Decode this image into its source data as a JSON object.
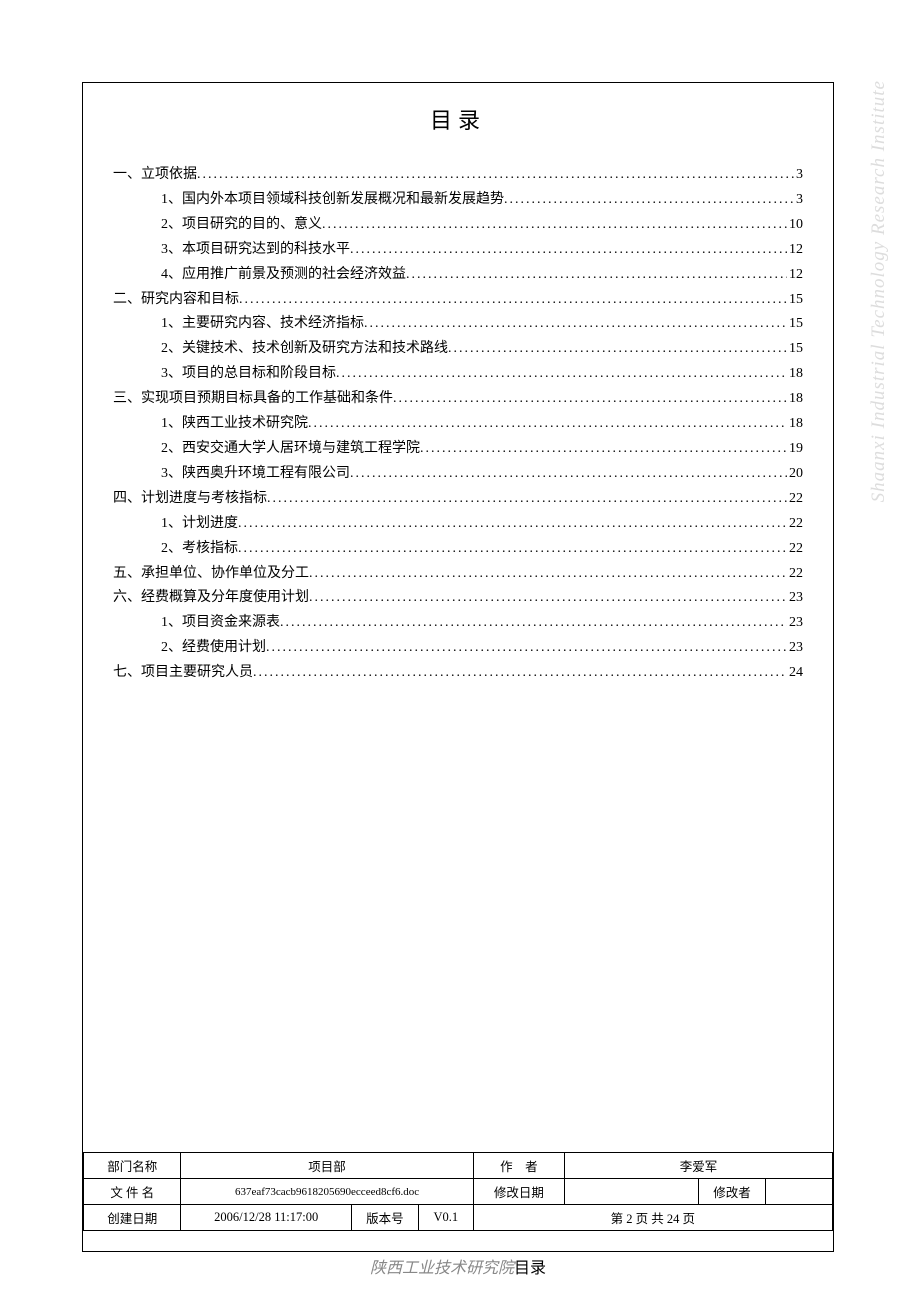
{
  "title": "目录",
  "watermark": "Shaanxi Industrial Technology Research Institute",
  "toc": [
    {
      "level": 1,
      "label": "一、立项依据",
      "page": "3"
    },
    {
      "level": 2,
      "label": "1、国内外本项目领域科技创新发展概况和最新发展趋势",
      "page": "3"
    },
    {
      "level": 2,
      "label": "2、项目研究的目的、意义",
      "page": "10"
    },
    {
      "level": 2,
      "label": "3、本项目研究达到的科技水平",
      "page": "12"
    },
    {
      "level": 2,
      "label": "4、应用推广前景及预测的社会经济效益",
      "page": "12"
    },
    {
      "level": 1,
      "label": "二、研究内容和目标",
      "page": "15"
    },
    {
      "level": 2,
      "label": "1、主要研究内容、技术经济指标",
      "page": "15"
    },
    {
      "level": 2,
      "label": "2、关键技术、技术创新及研究方法和技术路线",
      "page": "15"
    },
    {
      "level": 2,
      "label": "3、项目的总目标和阶段目标",
      "page": "18"
    },
    {
      "level": 1,
      "label": "三、实现项目预期目标具备的工作基础和条件",
      "page": "18"
    },
    {
      "level": 2,
      "label": "1、陕西工业技术研究院",
      "page": "18"
    },
    {
      "level": 2,
      "label": "2、西安交通大学人居环境与建筑工程学院",
      "page": "19"
    },
    {
      "level": 2,
      "label": "3、陕西奥升环境工程有限公司",
      "page": "20"
    },
    {
      "level": 1,
      "label": "四、计划进度与考核指标",
      "page": "22"
    },
    {
      "level": 2,
      "label": "1、计划进度",
      "page": "22"
    },
    {
      "level": 2,
      "label": "2、考核指标",
      "page": "22"
    },
    {
      "level": 1,
      "label": "五、承担单位、协作单位及分工",
      "page": "22"
    },
    {
      "level": 1,
      "label": "六、经费概算及分年度使用计划",
      "page": "23"
    },
    {
      "level": 2,
      "label": "1、项目资金来源表",
      "page": "23"
    },
    {
      "level": 2,
      "label": "2、经费使用计划",
      "page": "23"
    },
    {
      "level": 1,
      "label": "七、项目主要研究人员",
      "page": "24"
    }
  ],
  "footer": {
    "labels": {
      "dept": "部门名称",
      "project_dept": "项目部",
      "author": "作　者",
      "filename": "文 件 名",
      "modify_date": "修改日期",
      "modifier": "修改者",
      "create_date": "创建日期",
      "version": "版本号"
    },
    "values": {
      "author_name": "李爱军",
      "filename": "637eaf73cacb9618205690ecceed8cf6.doc",
      "modify_date": "",
      "modifier": "",
      "create_date": "2006/12/28 11:17:00",
      "version": "V0.1",
      "page_info": "第 2 页 共 24 页"
    }
  },
  "footer_caption": {
    "org": "陕西工业技术研究院",
    "suffix": "目录"
  }
}
